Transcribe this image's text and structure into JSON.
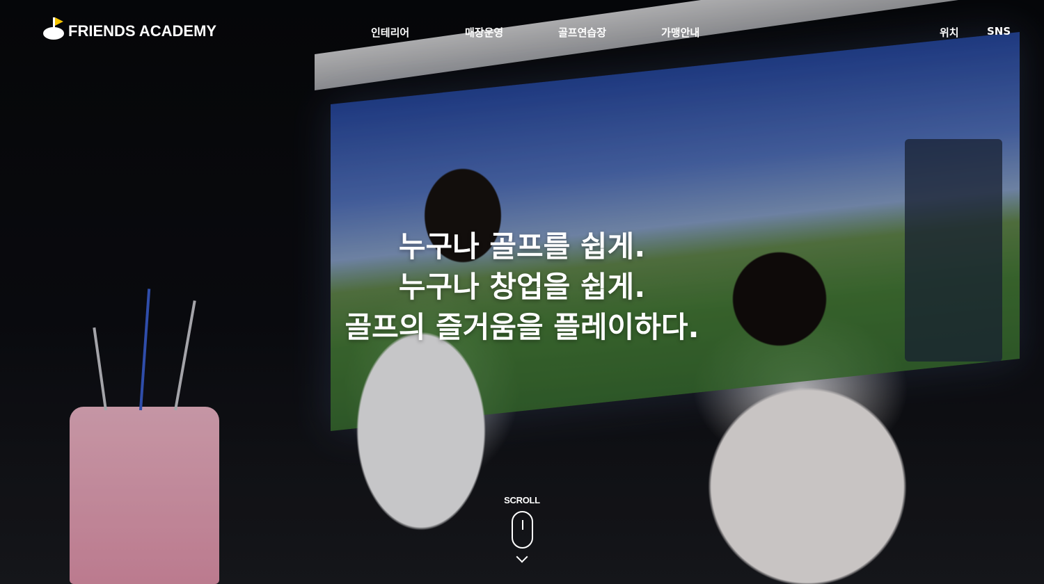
{
  "brand": {
    "name": "FRIENDS ACADEMY",
    "flag_color": "#f5c400"
  },
  "nav": {
    "items": [
      {
        "label": "인테리어"
      },
      {
        "label": "매장운영"
      },
      {
        "label": "골프연습장"
      },
      {
        "label": "가맹안내"
      },
      {
        "label": "위치"
      },
      {
        "label": "SNS"
      }
    ]
  },
  "hero": {
    "lines": [
      "누구나 골프를 쉽게.",
      "누구나 창업을 쉽게.",
      "골프의 즐거움을 플레이하다."
    ]
  },
  "scroll": {
    "label": "SCROLL"
  }
}
